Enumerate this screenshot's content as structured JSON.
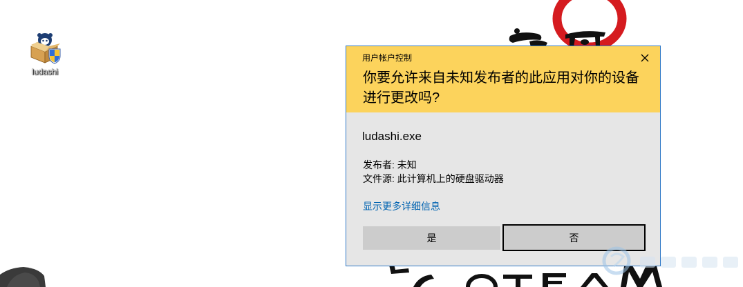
{
  "desktop": {
    "icons": [
      {
        "label": "ludashi",
        "icon": "ludashi-installer-icon"
      }
    ]
  },
  "uac": {
    "title": "用户帐户控制",
    "close_icon": "close-icon",
    "question": "你要允许来自未知发布者的此应用对你的设备进行更改吗?",
    "program_name": "ludashi.exe",
    "publisher": "发布者: 未知",
    "file_origin": "文件源: 此计算机上的硬盘驱动器",
    "details_link": "显示更多详细信息",
    "yes_label": "是",
    "no_label": "否"
  },
  "colors": {
    "uac_header": "#fcd35c",
    "uac_body": "#e6e6e6",
    "uac_border": "#2e78c6",
    "uac_link": "#0063b1",
    "uac_button": "#cccccc",
    "brush_red": "#d51b1f",
    "brush_black": "#111111"
  }
}
